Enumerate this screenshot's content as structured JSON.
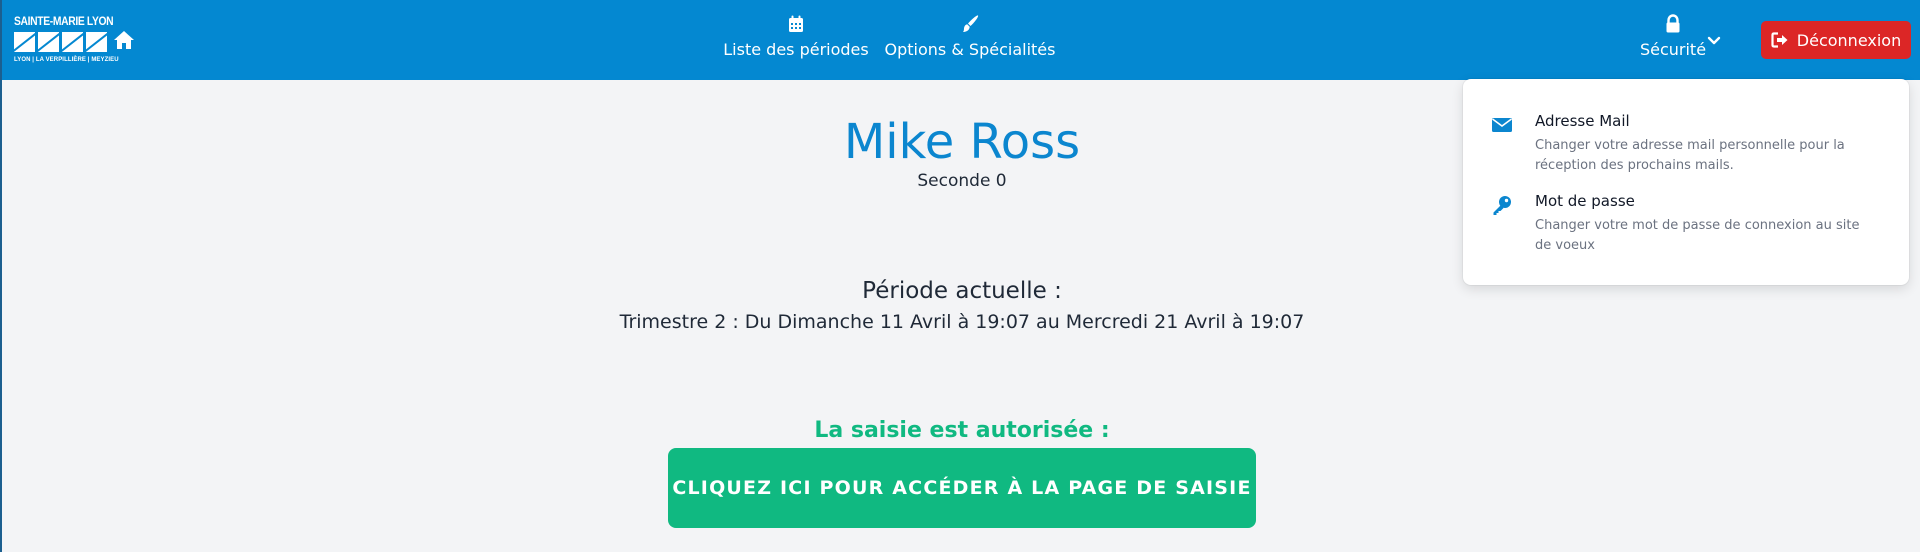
{
  "logo": {
    "title": "SAINTE-MARIE LYON",
    "subtitle": "LYON | LA VERPILLIÈRE | MEYZIEU"
  },
  "nav": {
    "periodes_label": "Liste des périodes",
    "periodes_icon": "calendar-icon",
    "options_label": "Options & Spécialités",
    "options_icon": "paint-brush-icon",
    "securite_label": "Sécurité",
    "securite_icon": "lock-icon",
    "logout_label": "Déconnexion",
    "logout_icon": "sign-out-icon"
  },
  "student": {
    "name": "Mike Ross",
    "class": "Seconde 0"
  },
  "period": {
    "title": "Période actuelle :",
    "dates": "Trimestre 2 : Du Dimanche 11 Avril à 19:07 au Mercredi 21 Avril à 19:07"
  },
  "saisie": {
    "status": "La saisie est autorisée :",
    "button_label": "CLIQUEZ ICI POUR ACCÉDER À LA PAGE DE SAISIE"
  },
  "security_menu": {
    "items": [
      {
        "title": "Adresse Mail",
        "description": "Changer votre adresse mail personnelle pour la réception des prochains mails.",
        "icon": "envelope-icon"
      },
      {
        "title": "Mot de passe",
        "description": "Changer votre mot de passe de connexion au site de voeux",
        "icon": "key-icon"
      }
    ]
  },
  "colors": {
    "navbar": "#0488d1",
    "accent_blue": "#0b86cf",
    "danger": "#dc2626",
    "success": "#10b981",
    "background": "#f3f4f6"
  }
}
